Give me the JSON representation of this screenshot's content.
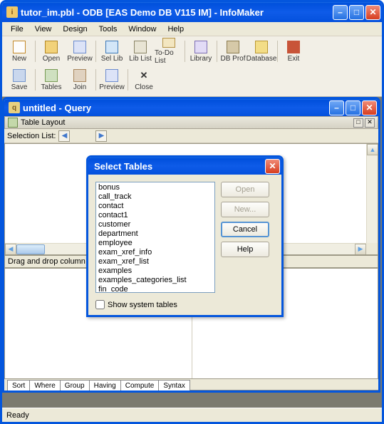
{
  "window": {
    "title": "tutor_im.pbl - ODB [EAS Demo DB V115 IM]  - InfoMaker"
  },
  "menu": {
    "items": [
      "File",
      "View",
      "Design",
      "Tools",
      "Window",
      "Help"
    ]
  },
  "toolbar": {
    "row1": [
      {
        "name": "new",
        "label": "New"
      },
      {
        "name": "open",
        "label": "Open"
      },
      {
        "name": "preview",
        "label": "Preview"
      },
      {
        "name": "sellib",
        "label": "Sel Lib"
      },
      {
        "name": "liblist",
        "label": "Lib List"
      },
      {
        "name": "todo",
        "label": "To-Do List"
      },
      {
        "name": "library",
        "label": "Library"
      },
      {
        "name": "dbprof",
        "label": "DB Prof"
      },
      {
        "name": "database",
        "label": "Database"
      },
      {
        "name": "exit",
        "label": "Exit"
      }
    ],
    "row2": [
      {
        "name": "save",
        "label": "Save"
      },
      {
        "name": "tables",
        "label": "Tables"
      },
      {
        "name": "join",
        "label": "Join"
      },
      {
        "name": "preview2",
        "label": "Preview"
      },
      {
        "name": "close",
        "label": "Close"
      }
    ]
  },
  "child": {
    "title": "untitled - Query",
    "panel_header": "Table Layout",
    "selection_label": "Selection List:",
    "drag_hint": "Drag and drop column",
    "tabs": [
      "Sort",
      "Where",
      "Group",
      "Having",
      "Compute",
      "Syntax"
    ]
  },
  "modal": {
    "title": "Select Tables",
    "items": [
      "bonus",
      "call_track",
      "contact",
      "contact1",
      "customer",
      "department",
      "employee",
      "exam_xref_info",
      "exam_xref_list",
      "examples",
      "examples_categories_list",
      "fin_code"
    ],
    "checkbox_label": "Show system tables",
    "buttons": {
      "open": "Open",
      "new": "New...",
      "cancel": "Cancel",
      "help": "Help"
    }
  },
  "status": {
    "text": "Ready"
  }
}
